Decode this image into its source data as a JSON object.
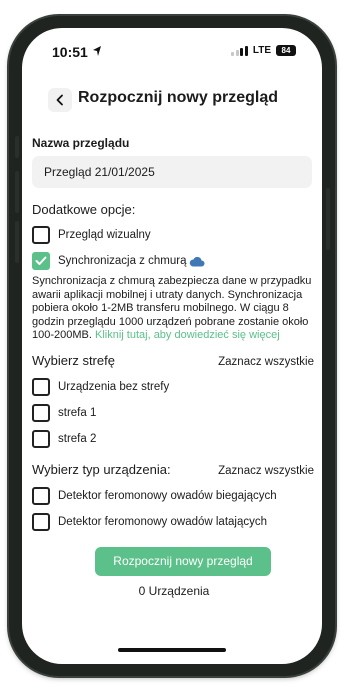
{
  "status_bar": {
    "time": "10:51",
    "network": "LTE",
    "battery": "84"
  },
  "header": {
    "title": "Rozpocznij nowy przegląd"
  },
  "inspection_name": {
    "label": "Nazwa przeglądu",
    "value": "Przegląd 21/01/2025"
  },
  "additional_options": {
    "title": "Dodatkowe opcje:",
    "visual_inspection": {
      "label": "Przegląd wizualny",
      "checked": false
    },
    "cloud_sync": {
      "label": "Synchronizacja z chmurą",
      "checked": true,
      "description": "Synchronizacja z chmurą zabezpiecza dane w przypadku awarii aplikacji mobilnej i utraty danych. Synchronizacja pobiera około 1-2MB transferu mobilnego. W ciągu 8 godzin przeglądu 1000 urządzeń pobrane zostanie około 100-200MB.",
      "link": "Kliknij tutaj, aby dowiedzieć się więcej"
    }
  },
  "zones": {
    "title": "Wybierz strefę",
    "select_all": "Zaznacz wszystkie",
    "items": [
      {
        "label": "Urządzenia bez strefy",
        "checked": false
      },
      {
        "label": "strefa 1",
        "checked": false
      },
      {
        "label": "strefa 2",
        "checked": false
      }
    ]
  },
  "device_types": {
    "title": "Wybierz typ urządzenia:",
    "select_all": "Zaznacz wszystkie",
    "items": [
      {
        "label": "Detektor feromonowy owadów biegających",
        "checked": false
      },
      {
        "label": "Detektor feromonowy owadów latających",
        "checked": false
      }
    ]
  },
  "actions": {
    "start_button": "Rozpocznij nowy przegląd",
    "device_count": "0 Urządzenia"
  },
  "colors": {
    "accent": "#5cc08a",
    "cloud_icon": "#3f78b5",
    "input_background": "#f2f2f2"
  },
  "icons": {
    "back": "chevron-left-icon",
    "cloud": "cloud-icon",
    "location": "location-arrow-icon",
    "check": "checkmark-icon"
  }
}
